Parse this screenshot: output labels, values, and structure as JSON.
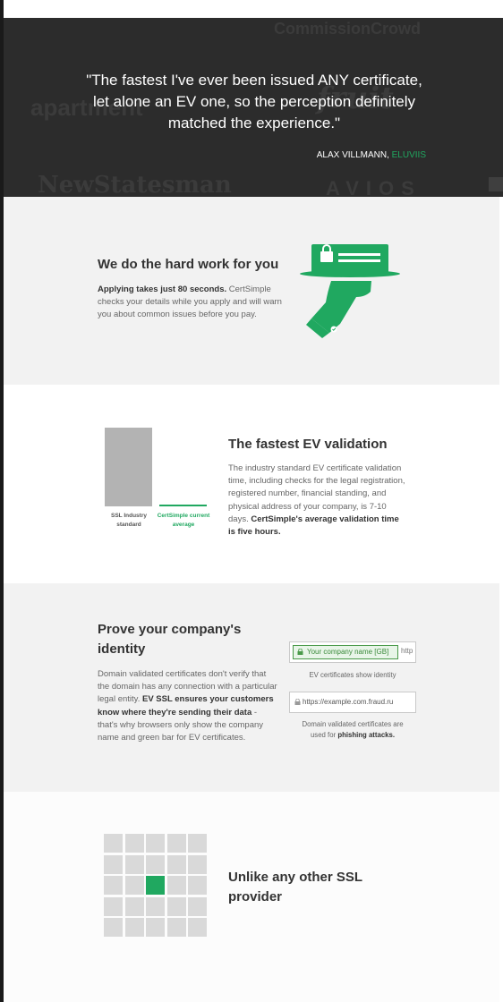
{
  "hero": {
    "quote": "\"The fastest I've ever been issued ANY certificate, let alone an EV one, so the perception definitely matched the experience.\"",
    "author": "ALAX VILLMANN, ",
    "company": "ELUVIIS",
    "background_logos": [
      "CommissionCrowd",
      "apartment",
      "NewStatesman",
      "AVIOS",
      "fruit"
    ]
  },
  "hard_work": {
    "title": "We do the hard work for you",
    "bold": "Applying takes just 80 seconds.",
    "text": " CertSimple checks your details while you apply and will warn you about common issues before you pay.",
    "icon": "certificate-on-platter-icon"
  },
  "fastest": {
    "title": "The fastest EV validation",
    "text": "The industry standard EV certificate validation time, including checks for the legal registration, registered number, financial standing, and physical address of your company, is 7-10 days.",
    "bold": "CertSimple's average validation time is five hours."
  },
  "chart_data": {
    "type": "bar",
    "categories": [
      "SSL Industry standard",
      "CertSimple current average"
    ],
    "values": [
      204,
      5
    ],
    "colors": [
      "#b3b3b3",
      "#20a860"
    ]
  },
  "identity": {
    "title_line1": "Prove your company's",
    "title_line2": "identity",
    "text1": "Domain validated certificates don't verify that the domain has any connection with a particular legal entity.",
    "bold": "EV SSL ensures your customers know where they're sending their data",
    "text2": " - that's why browsers only show the company name and green bar for EV certificates.",
    "ev_bar_text": "Your company name [GB]",
    "ev_bar_tail": "http",
    "ev_caption": "EV certificates show identity",
    "dv_bar_text": "https://example.com.fraud.ru",
    "dv_caption_1": "Domain validated certificates are",
    "dv_caption_2": "used for ",
    "dv_caption_bold": "phishing attacks."
  },
  "unlike": {
    "title_line1": "Unlike any other SSL",
    "title_line2": "provider",
    "highlight_cell": 12
  },
  "colors": {
    "accent": "#20a860",
    "hero_bg": "#2c2c2c",
    "section_grey": "#f2f2f2"
  }
}
